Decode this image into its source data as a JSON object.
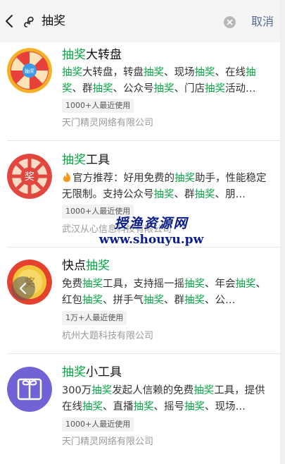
{
  "search": {
    "query": "抽奖",
    "cancel_label": "取消"
  },
  "results": [
    {
      "title": [
        {
          "t": "抽奖",
          "h": true
        },
        {
          "t": "大转盘",
          "h": false
        }
      ],
      "desc": [
        {
          "t": "抽奖",
          "h": true
        },
        {
          "t": "大转盘，转盘",
          "h": false
        },
        {
          "t": "抽奖",
          "h": true
        },
        {
          "t": "、现场",
          "h": false
        },
        {
          "t": "抽奖",
          "h": true
        },
        {
          "t": "、在线",
          "h": false
        },
        {
          "t": "抽奖",
          "h": true
        },
        {
          "t": "、群",
          "h": false
        },
        {
          "t": "抽奖",
          "h": true
        },
        {
          "t": "、公众号",
          "h": false
        },
        {
          "t": "抽奖",
          "h": true
        },
        {
          "t": "、门店",
          "h": false
        },
        {
          "t": "抽奖",
          "h": true
        },
        {
          "t": "活动…",
          "h": false
        }
      ],
      "badge": "1000+人最近使用",
      "company": "天门精灵网络有限公司",
      "logo_text": "抽奖"
    },
    {
      "title": [
        {
          "t": "抽奖",
          "h": true
        },
        {
          "t": "工具",
          "h": false
        }
      ],
      "desc": [
        {
          "t": "官方推荐：好用免费的",
          "h": false
        },
        {
          "t": "抽奖",
          "h": true
        },
        {
          "t": "助手，性能稳定无限制。支持公众号",
          "h": false
        },
        {
          "t": "抽奖",
          "h": true
        },
        {
          "t": "、群",
          "h": false
        },
        {
          "t": "抽奖",
          "h": true
        },
        {
          "t": "、朋…",
          "h": false
        }
      ],
      "badge": "1000+人最近使用",
      "company": "武汉从心信息科技有限公司",
      "logo_text": "奖"
    },
    {
      "title": [
        {
          "t": "快点",
          "h": false
        },
        {
          "t": "抽奖",
          "h": true
        }
      ],
      "desc": [
        {
          "t": "免费",
          "h": false
        },
        {
          "t": "抽奖",
          "h": true
        },
        {
          "t": "工具，支持摇一摇",
          "h": false
        },
        {
          "t": "抽奖",
          "h": true
        },
        {
          "t": "、年会",
          "h": false
        },
        {
          "t": "抽奖",
          "h": true
        },
        {
          "t": "、红包",
          "h": false
        },
        {
          "t": "抽奖",
          "h": true
        },
        {
          "t": "、拼手气",
          "h": false
        },
        {
          "t": "抽奖",
          "h": true
        },
        {
          "t": "、群",
          "h": false
        },
        {
          "t": "抽奖",
          "h": true
        },
        {
          "t": "、公…",
          "h": false
        }
      ],
      "badge": "1万+人最近使用",
      "company": "杭州大题科技有限公司",
      "logo_text": "奖"
    },
    {
      "title": [
        {
          "t": "抽奖",
          "h": true
        },
        {
          "t": "小工具",
          "h": false
        }
      ],
      "desc": [
        {
          "t": "300万",
          "h": false
        },
        {
          "t": "抽奖",
          "h": true
        },
        {
          "t": "发起人信赖的免费",
          "h": false
        },
        {
          "t": "抽奖",
          "h": true
        },
        {
          "t": "工具，提供在线",
          "h": false
        },
        {
          "t": "抽奖",
          "h": true
        },
        {
          "t": "、直播",
          "h": false
        },
        {
          "t": "抽奖",
          "h": true
        },
        {
          "t": "、摇号",
          "h": false
        },
        {
          "t": "抽奖",
          "h": true
        },
        {
          "t": "、现场…",
          "h": false
        }
      ],
      "badge": "1000+人最近使用",
      "company": "天门精灵网络有限公司",
      "logo_text": ""
    }
  ],
  "watermark": {
    "line1": "授渔资源网",
    "line2": "www.shouyu.pw"
  },
  "colors": {
    "highlight": "#07a744",
    "cancel": "#576b95",
    "company": "#999999"
  },
  "icons": [
    "back-arrow-icon",
    "mini-program-icon",
    "clear-icon",
    "fire-icon",
    "prev-arrow-icon"
  ]
}
